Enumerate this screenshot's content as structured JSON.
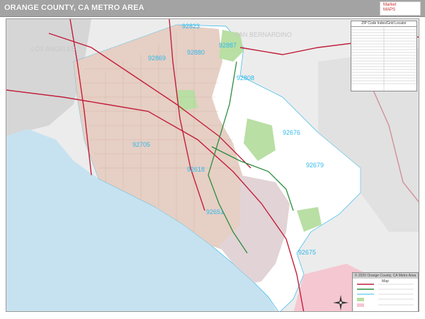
{
  "header": {
    "title": "ORANGE COUNTY, CA METRO AREA",
    "logo_text": "Market\nMAPS"
  },
  "map": {
    "zip_labels": [
      "92869",
      "92823",
      "92887",
      "92880",
      "92808",
      "92676",
      "92679",
      "92705",
      "92618",
      "92651",
      "92675"
    ],
    "place_labels": [
      "LOS ANGELES",
      "SAN BERNARDINO"
    ]
  },
  "zip_index": {
    "heading": "ZIP Code Index/Grid Locator"
  },
  "legend": {
    "heading": "© 2020 Orange County, CA Metro Area Map"
  },
  "colors": {
    "header_bg": "#a3a3a3",
    "ocean": "#c6e2f0",
    "urban": "#e8d3c9",
    "county": "#ffffff",
    "outside": "#d2d2d2",
    "highway": "#c21f3c",
    "freeway_green": "#2e8b3e",
    "parks": "#b9dfa4",
    "zip_text": "#31b9ec"
  }
}
